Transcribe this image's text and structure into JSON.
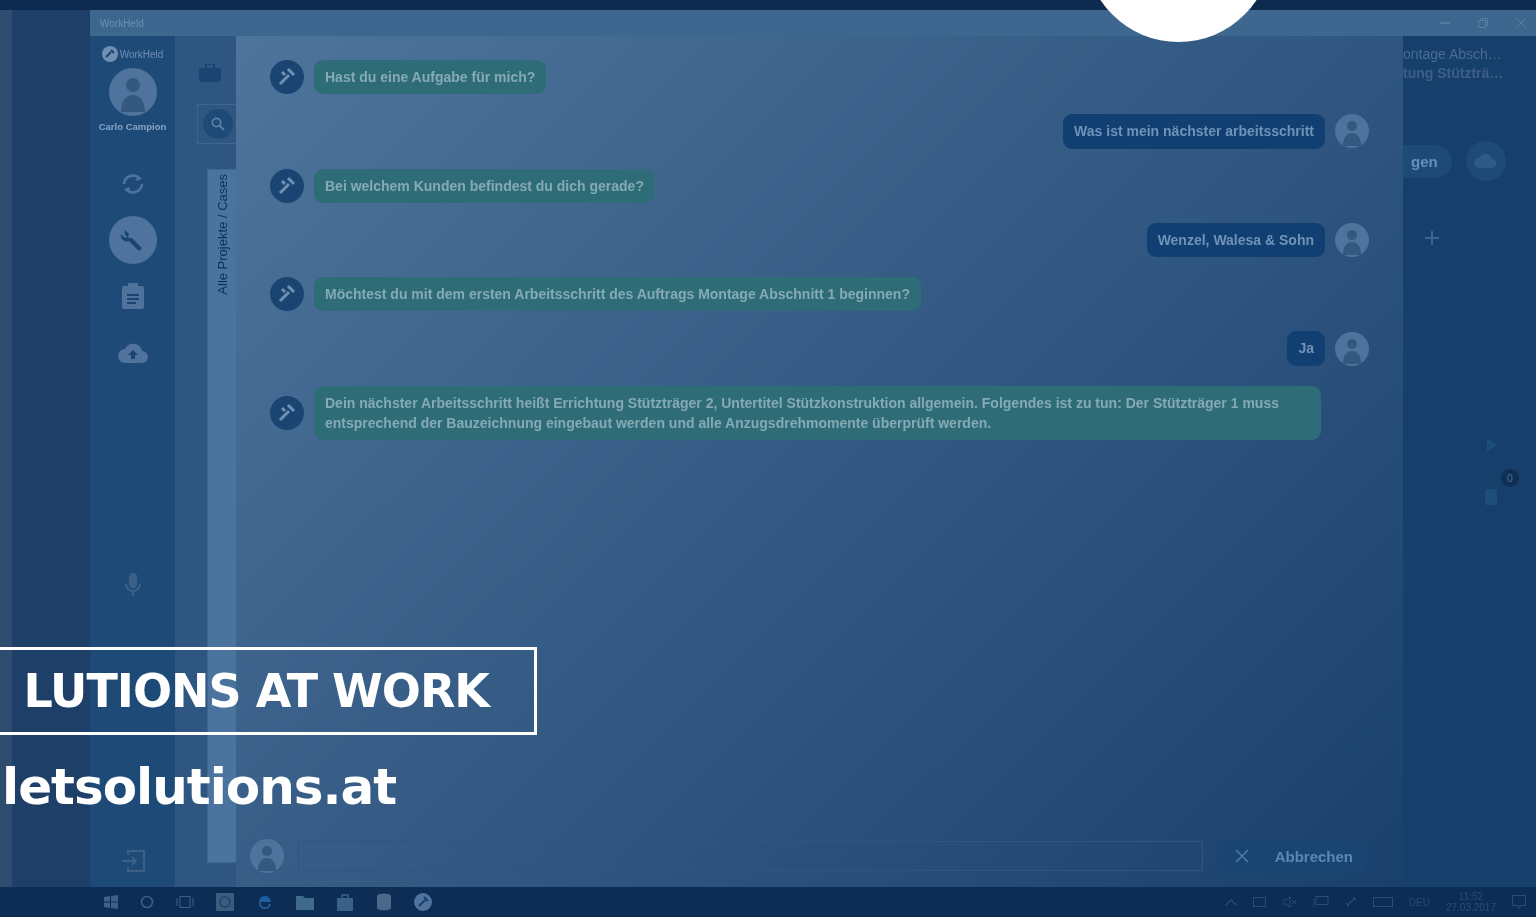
{
  "window": {
    "title": "WorkHeld"
  },
  "sidebar": {
    "logo_text": "WorkHeld",
    "user_name": "Carlo Campion",
    "items": [
      {
        "kind": "sync",
        "selected": false
      },
      {
        "kind": "wrench",
        "selected": true
      },
      {
        "kind": "clipboard",
        "selected": false
      },
      {
        "kind": "upload",
        "selected": false
      }
    ]
  },
  "projects_panel": {
    "vertical_tab": "Alle Projekte / Cases"
  },
  "chat": {
    "messages": [
      {
        "kind": "bot",
        "text": "Hast du eine Aufgabe für mich?"
      },
      {
        "kind": "user",
        "text": "Was ist mein nächster arbeitsschritt"
      },
      {
        "kind": "bot",
        "text": "Bei welchem Kunden befindest du dich gerade?"
      },
      {
        "kind": "user",
        "text": "Wenzel, Walesa & Sohn"
      },
      {
        "kind": "bot",
        "text": "Möchtest du mit dem ersten Arbeitsschritt des Auftrags Montage Abschnitt 1 beginnen?"
      },
      {
        "kind": "user",
        "text": "Ja"
      },
      {
        "kind": "bot",
        "text": "Dein nächster Arbeitsschritt heißt Errichtung Stützträger 2, Untertitel Stützkonstruktion allgemein. Folgendes ist zu tun: Der Stützträger 1 muss entsprechend der Bauzeichnung eingebaut werden und alle Anzugsdrehmomente überprüft werden."
      }
    ],
    "cancel_button": "Abbrechen"
  },
  "detail_panel": {
    "line_1": "ontage Absch…",
    "line_2": "tung Stützträ…",
    "button": "gen",
    "clipboard_badge": "0"
  },
  "taskbar": {
    "language": "DEU",
    "time": "11:52",
    "date": "27.03.2017"
  },
  "banner": {
    "headline": "LUTIONS AT WORK",
    "url": "letsolutions.at"
  }
}
